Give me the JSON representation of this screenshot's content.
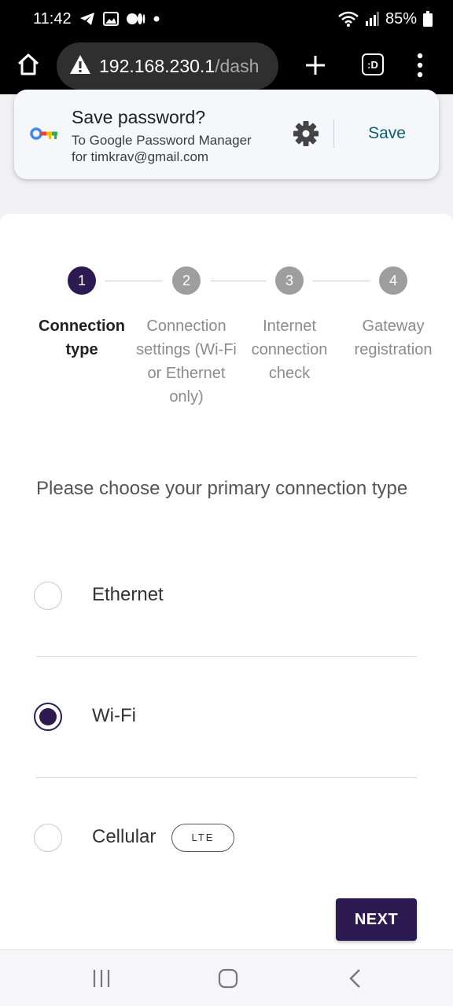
{
  "status_bar": {
    "time": "11:42",
    "battery": "85%"
  },
  "browser": {
    "url_host": "192.168.230.1",
    "url_path": "/dash",
    "tab_count": ":D"
  },
  "password_prompt": {
    "title": "Save password?",
    "subtitle_line1": "To Google Password Manager",
    "subtitle_line2": "for timkrav@gmail.com",
    "save_label": "Save"
  },
  "stepper": {
    "steps": [
      {
        "number": "1",
        "label": "Connection type",
        "active": true
      },
      {
        "number": "2",
        "label": "Connection settings (Wi-Fi or Ethernet only)",
        "active": false
      },
      {
        "number": "3",
        "label": "Internet connection check",
        "active": false
      },
      {
        "number": "4",
        "label": "Gateway registration",
        "active": false
      }
    ]
  },
  "main": {
    "prompt": "Please choose your primary connection type",
    "options": [
      {
        "label": "Ethernet",
        "selected": false
      },
      {
        "label": "Wi-Fi",
        "selected": true
      },
      {
        "label": "Cellular",
        "selected": false,
        "badge": "LTE"
      }
    ],
    "next_label": "NEXT"
  },
  "colors": {
    "accent": "#2d1a52",
    "link": "#0b5f73"
  }
}
